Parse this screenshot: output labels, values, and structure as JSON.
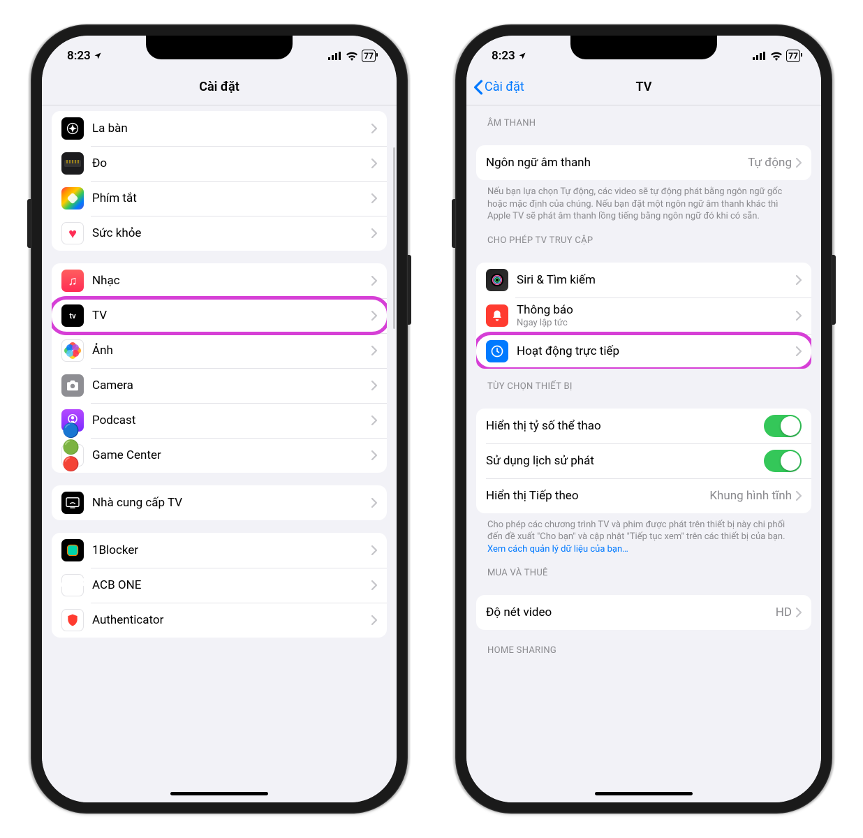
{
  "status": {
    "time": "8:23",
    "battery": "77"
  },
  "left": {
    "title": "Cài đặt",
    "g1": [
      {
        "id": "compass",
        "label": "La bàn",
        "icon": "compass"
      },
      {
        "id": "measure",
        "label": "Đo",
        "icon": "measure"
      },
      {
        "id": "shortcuts",
        "label": "Phím tắt",
        "icon": "shortcuts"
      },
      {
        "id": "health",
        "label": "Sức khỏe",
        "icon": "health"
      }
    ],
    "g2": [
      {
        "id": "music",
        "label": "Nhạc",
        "icon": "music"
      },
      {
        "id": "tv",
        "label": "TV",
        "icon": "tv",
        "hl": true
      },
      {
        "id": "photos",
        "label": "Ảnh",
        "icon": "photos"
      },
      {
        "id": "camera",
        "label": "Camera",
        "icon": "camera"
      },
      {
        "id": "podcast",
        "label": "Podcast",
        "icon": "podcast"
      },
      {
        "id": "gamecenter",
        "label": "Game Center",
        "icon": "gamecenter"
      }
    ],
    "g3": [
      {
        "id": "tvprovider",
        "label": "Nhà cung cấp TV",
        "icon": "tvprov"
      }
    ],
    "g4": [
      {
        "id": "1blocker",
        "label": "1Blocker",
        "icon": "1block"
      },
      {
        "id": "acb",
        "label": "ACB ONE",
        "icon": "acb"
      },
      {
        "id": "auth",
        "label": "Authenticator",
        "icon": "auth"
      }
    ]
  },
  "right": {
    "back": "Cài đặt",
    "title": "TV",
    "s1": {
      "header": "ÂM THANH",
      "row": {
        "label": "Ngôn ngữ âm thanh",
        "value": "Tự động"
      },
      "footer": "Nếu bạn lựa chọn Tự động, các video sẽ tự động phát bằng ngôn ngữ gốc hoặc mặc định của chúng. Nếu bạn đặt một ngôn ngữ âm thanh khác thì Apple TV sẽ phát âm thanh lồng tiếng bằng ngôn ngữ đó khi có sẵn."
    },
    "s2": {
      "header": "CHO PHÉP TV TRUY CẬP",
      "rows": [
        {
          "id": "siri",
          "label": "Siri & Tìm kiếm",
          "icon": "siri"
        },
        {
          "id": "notif",
          "label": "Thông báo",
          "sub": "Ngay lập tức",
          "icon": "notif"
        },
        {
          "id": "live",
          "label": "Hoạt động trực tiếp",
          "icon": "live",
          "hl": true
        }
      ]
    },
    "s3": {
      "header": "TÙY CHỌN THIẾT BỊ",
      "rows": [
        {
          "id": "sports",
          "label": "Hiển thị tỷ số thể thao",
          "toggle": true
        },
        {
          "id": "history",
          "label": "Sử dụng lịch sử phát",
          "toggle": true
        },
        {
          "id": "upnext",
          "label": "Hiển thị Tiếp theo",
          "value": "Khung hình tĩnh"
        }
      ],
      "footer": "Cho phép các chương trình TV và phim được phát trên thiết bị này chi phối đến đề xuất \"Cho bạn\" và cập nhật \"Tiếp tục xem\" trên các thiết bị của bạn. ",
      "link": "Xem cách quản lý dữ liệu của bạn…"
    },
    "s4": {
      "header": "MUA VÀ THUÊ",
      "row": {
        "label": "Độ nét video",
        "value": "HD"
      }
    },
    "s5": {
      "header": "HOME SHARING"
    }
  }
}
